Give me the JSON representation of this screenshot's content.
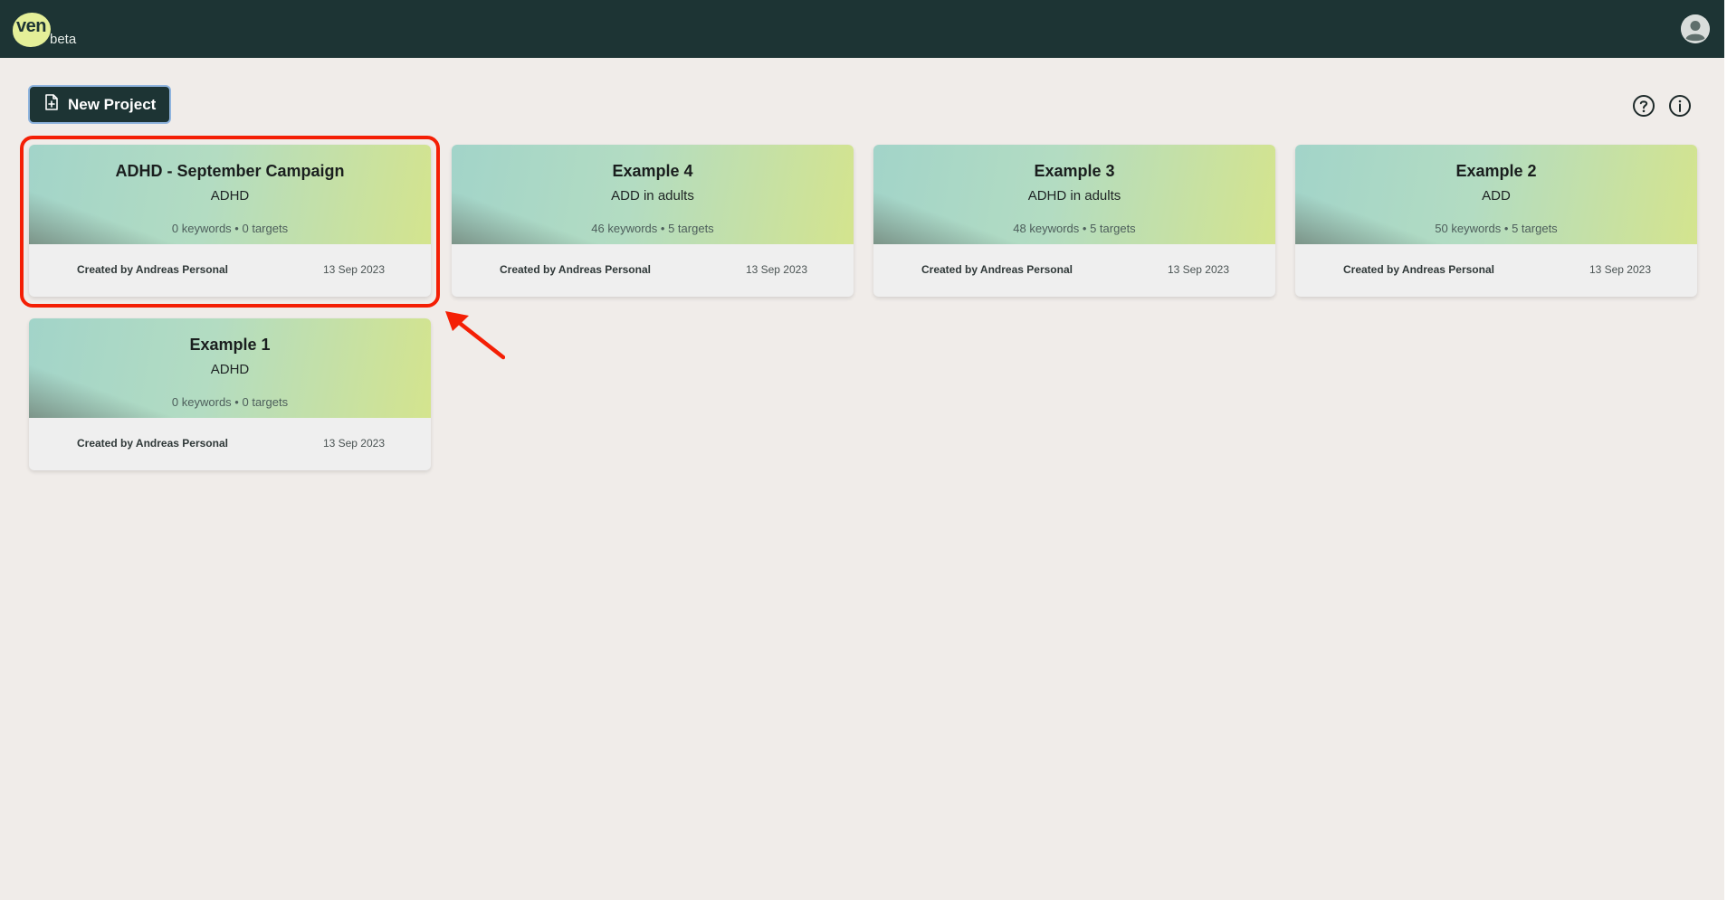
{
  "app": {
    "logo_text": "ven",
    "badge": "beta"
  },
  "toolbar": {
    "new_project_label": "New Project",
    "help_icon": "question-circle-icon",
    "info_icon": "info-circle-icon"
  },
  "projects": [
    {
      "title": "ADHD - September Campaign",
      "subtitle": "ADHD",
      "keywords": "0 keywords",
      "separator": "•",
      "targets": "0 targets",
      "creator": "Created by  Andreas Personal",
      "date": "13 Sep 2023"
    },
    {
      "title": "Example 4",
      "subtitle": "ADD in adults",
      "keywords": "46 keywords",
      "separator": "•",
      "targets": "5 targets",
      "creator": "Created by  Andreas Personal",
      "date": "13 Sep 2023"
    },
    {
      "title": "Example 3",
      "subtitle": "ADHD in adults",
      "keywords": "48 keywords",
      "separator": "•",
      "targets": "5 targets",
      "creator": "Created by  Andreas Personal",
      "date": "13 Sep 2023"
    },
    {
      "title": "Example 2",
      "subtitle": "ADD",
      "keywords": "50 keywords",
      "separator": "•",
      "targets": "5 targets",
      "creator": "Created by  Andreas Personal",
      "date": "13 Sep 2023"
    },
    {
      "title": "Example 1",
      "subtitle": "ADHD",
      "keywords": "0 keywords",
      "separator": "•",
      "targets": "0 targets",
      "creator": "Created by  Andreas Personal",
      "date": "13 Sep 2023"
    }
  ],
  "colors": {
    "topbar": "#1d3434",
    "background": "#f0ece9",
    "logo_accent": "#e4ef98",
    "annotation": "#f41f05"
  }
}
